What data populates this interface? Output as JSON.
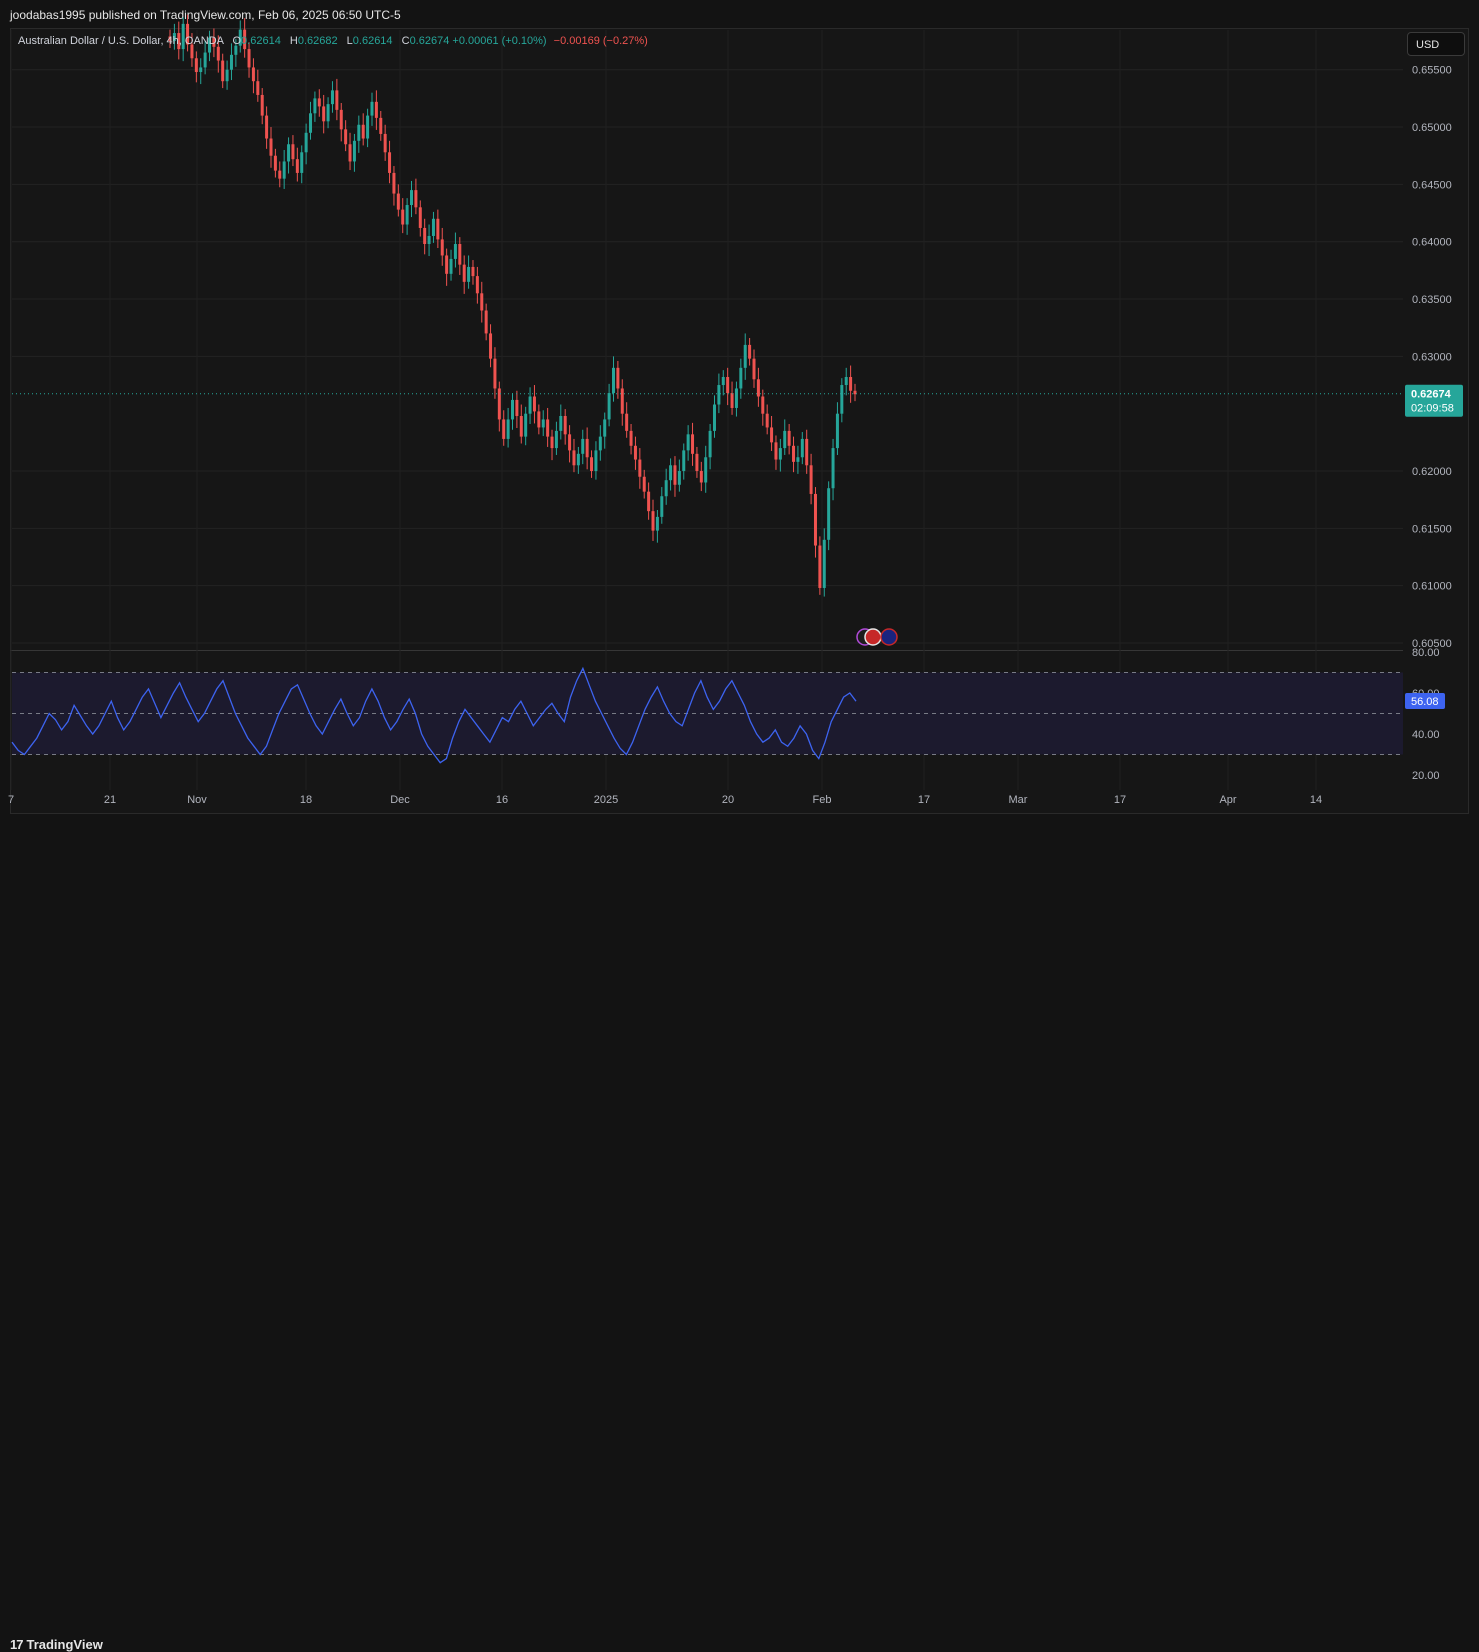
{
  "header": {
    "published": "joodabas1995 published on TradingView.com, Feb 06, 2025 06:50 UTC-5"
  },
  "legend": {
    "symbol": "Australian Dollar / U.S. Dollar, 4h, OANDA",
    "o_label": "O",
    "o_value": "0.62614",
    "h_label": "H",
    "h_value": "0.62682",
    "l_label": "L",
    "l_value": "0.62614",
    "c_label": "C",
    "c_value": "0.62674",
    "change": "+0.00061 (+0.10%)",
    "change2": "−0.00169 (−0.27%)"
  },
  "currency_button": "USD",
  "price_tag": {
    "value": "0.62674",
    "countdown": "02:09:58"
  },
  "rsi_tag": "56.08",
  "footer": {
    "brand": "TradingView"
  },
  "colors": {
    "up": "#26a69a",
    "down": "#ef5350",
    "rsi": "#3d63f0",
    "background": "#161616"
  },
  "chart_data": [
    {
      "type": "candlestick",
      "y_axis_ticks": [
        "0.65500",
        "0.65000",
        "0.64500",
        "0.64000",
        "0.63500",
        "0.63000",
        "0.62000",
        "0.61500",
        "0.61000",
        "0.60500"
      ],
      "ylim": [
        0.605,
        0.6555
      ],
      "x_axis_ticks": [
        "7",
        "21",
        "Nov",
        "18",
        "Dec",
        "16",
        "2025",
        "20",
        "Feb",
        "17",
        "Mar",
        "17",
        "Apr",
        "14"
      ],
      "last_price": 0.62674,
      "series": [
        {
          "name": "AUDUSD",
          "values": [
            0.6575,
            0.6582,
            0.6568,
            0.659,
            0.6572,
            0.656,
            0.6548,
            0.6552,
            0.6565,
            0.6578,
            0.657,
            0.6558,
            0.654,
            0.655,
            0.6563,
            0.6571,
            0.6585,
            0.6568,
            0.6552,
            0.654,
            0.6528,
            0.651,
            0.649,
            0.6475,
            0.6462,
            0.6455,
            0.647,
            0.6485,
            0.6472,
            0.646,
            0.6478,
            0.6495,
            0.6512,
            0.6525,
            0.6518,
            0.6505,
            0.652,
            0.6532,
            0.6515,
            0.6498,
            0.6485,
            0.647,
            0.6488,
            0.6502,
            0.649,
            0.651,
            0.6522,
            0.6508,
            0.6494,
            0.6478,
            0.646,
            0.6442,
            0.6428,
            0.6415,
            0.6432,
            0.6445,
            0.643,
            0.6412,
            0.6398,
            0.6405,
            0.642,
            0.6402,
            0.6388,
            0.6372,
            0.6385,
            0.6398,
            0.638,
            0.6365,
            0.6378,
            0.637,
            0.6355,
            0.634,
            0.632,
            0.6298,
            0.6272,
            0.6245,
            0.6228,
            0.6245,
            0.6262,
            0.6248,
            0.623,
            0.625,
            0.6265,
            0.6252,
            0.6238,
            0.6245,
            0.623,
            0.622,
            0.6235,
            0.6248,
            0.6232,
            0.6218,
            0.6205,
            0.6215,
            0.6228,
            0.6212,
            0.62,
            0.6218,
            0.623,
            0.6245,
            0.6268,
            0.629,
            0.6272,
            0.625,
            0.6235,
            0.6222,
            0.621,
            0.6195,
            0.6182,
            0.6165,
            0.6148,
            0.616,
            0.6178,
            0.6192,
            0.6205,
            0.6188,
            0.62,
            0.6218,
            0.6232,
            0.6215,
            0.62,
            0.619,
            0.6212,
            0.6235,
            0.6258,
            0.6275,
            0.6282,
            0.6268,
            0.6255,
            0.6272,
            0.629,
            0.631,
            0.6298,
            0.628,
            0.6265,
            0.625,
            0.6238,
            0.6225,
            0.621,
            0.622,
            0.6235,
            0.6222,
            0.6208,
            0.6212,
            0.6228,
            0.6205,
            0.618,
            0.6135,
            0.6098,
            0.614,
            0.6185,
            0.622,
            0.625,
            0.6275,
            0.6282,
            0.627,
            0.6267
          ]
        }
      ]
    },
    {
      "type": "line",
      "name": "RSI",
      "y_axis_ticks": [
        "80.00",
        "60.00",
        "40.00",
        "20.00"
      ],
      "ylim": [
        20,
        80
      ],
      "bands": [
        70,
        50,
        30
      ],
      "last_value": 56.08,
      "series": [
        {
          "name": "",
          "values": [
            36,
            32,
            30,
            34,
            38,
            44,
            50,
            47,
            42,
            46,
            54,
            49,
            44,
            40,
            44,
            50,
            56,
            48,
            42,
            46,
            52,
            58,
            62,
            55,
            48,
            54,
            60,
            65,
            58,
            52,
            46,
            50,
            56,
            62,
            66,
            58,
            50,
            44,
            38,
            34,
            30,
            34,
            42,
            50,
            56,
            62,
            64,
            57,
            50,
            44,
            40,
            46,
            52,
            57,
            50,
            44,
            48,
            56,
            62,
            56,
            48,
            42,
            46,
            52,
            57,
            50,
            40,
            34,
            30,
            26,
            28,
            38,
            46,
            52,
            48,
            44,
            40,
            36,
            42,
            48,
            46,
            52,
            56,
            50,
            44,
            48,
            52,
            55,
            50,
            46,
            58,
            66,
            72,
            64,
            56,
            50,
            44,
            38,
            33,
            30,
            36,
            44,
            52,
            58,
            63,
            56,
            50,
            46,
            44,
            52,
            60,
            66,
            58,
            52,
            56,
            62,
            66,
            60,
            54,
            46,
            40,
            36,
            38,
            42,
            36,
            34,
            38,
            44,
            40,
            32,
            28,
            36,
            46,
            52,
            58,
            60,
            56
          ]
        }
      ]
    }
  ]
}
